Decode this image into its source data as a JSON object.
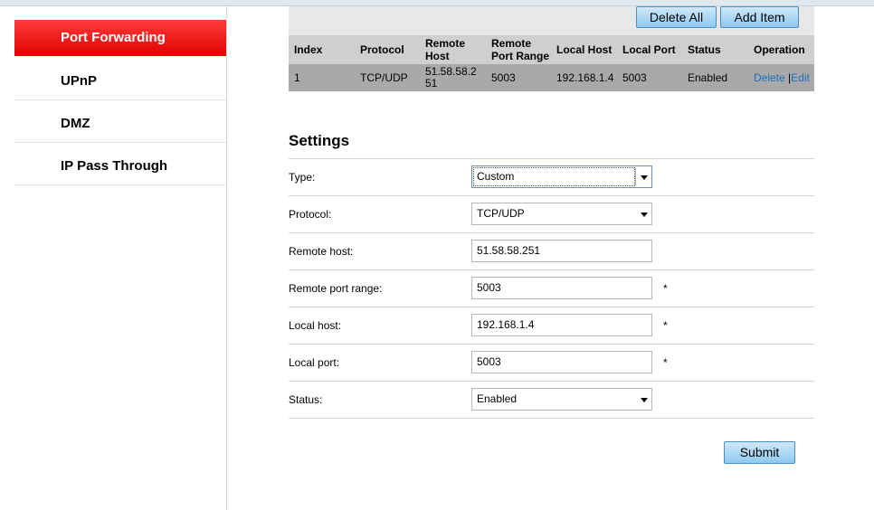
{
  "sidebar": {
    "items": [
      {
        "label": "Port Forwarding",
        "active": true
      },
      {
        "label": "UPnP"
      },
      {
        "label": "DMZ"
      },
      {
        "label": "IP Pass Through"
      }
    ]
  },
  "toolbar": {
    "delete_all_label": "Delete All",
    "add_item_label": "Add Item"
  },
  "table": {
    "headers": [
      "Index",
      "Protocol",
      "Remote Host",
      "Remote Port Range",
      "Local Host",
      "Local Port",
      "Status",
      "Operation"
    ],
    "rows": [
      {
        "index": "1",
        "protocol": "TCP/UDP",
        "remote_host": "51.58.58.251",
        "remote_port_range": "5003",
        "local_host": "192.168.1.4",
        "local_port": "5003",
        "status": "Enabled",
        "op_delete": "Delete",
        "op_sep": "|",
        "op_edit": "Edit"
      }
    ]
  },
  "settings": {
    "title": "Settings",
    "type_label": "Type:",
    "type_value": "Custom",
    "protocol_label": "Protocol:",
    "protocol_value": "TCP/UDP",
    "remote_host_label": "Remote host:",
    "remote_host_value": "51.58.58.251",
    "remote_port_range_label": "Remote port range:",
    "remote_port_range_value": "5003",
    "local_host_label": "Local host:",
    "local_host_value": "192.168.1.4",
    "local_port_label": "Local port:",
    "local_port_value": "5003",
    "status_label": "Status:",
    "status_value": "Enabled",
    "required_mark": "*",
    "submit_label": "Submit"
  },
  "colors": {
    "active_tab": "#e10000",
    "button": "#8ec9f0",
    "link": "#1f6fc1"
  }
}
